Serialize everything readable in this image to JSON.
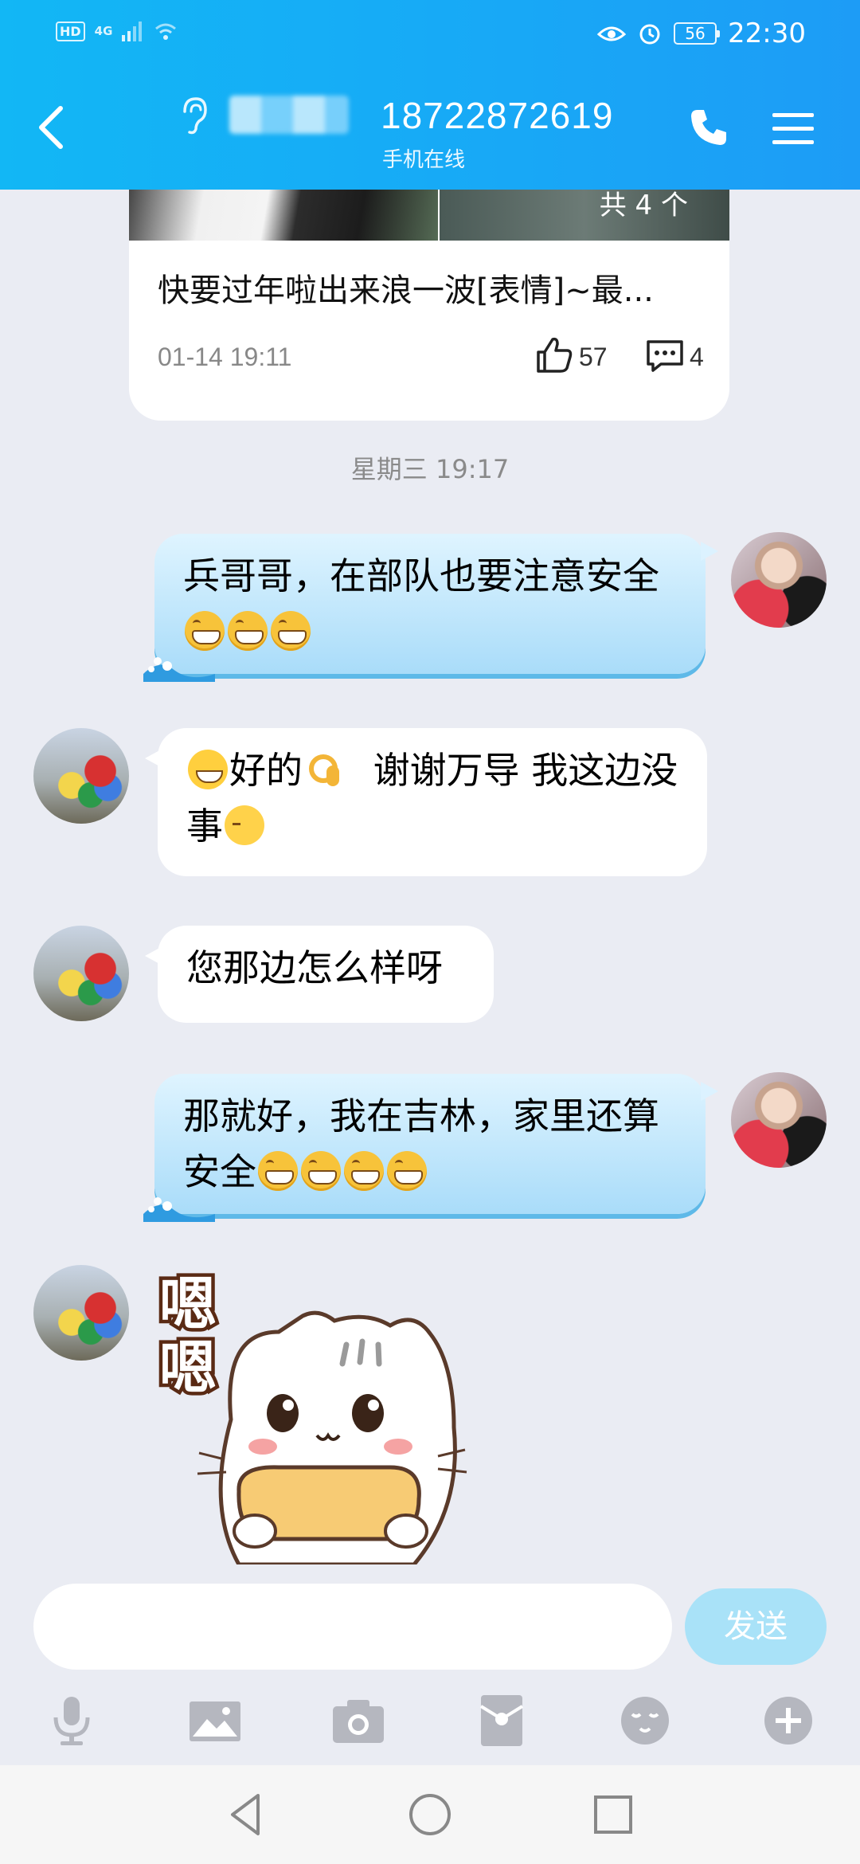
{
  "status_bar": {
    "hd": "HD",
    "network": "4G",
    "battery": "56",
    "time": "22:30"
  },
  "header": {
    "title": "18722872619",
    "subtitle": "手机在线"
  },
  "card": {
    "image_count": "共 4 个",
    "text": "快要过年啦出来浪一波[表情]~最...",
    "date": "01-14 19:11",
    "likes": "57",
    "comments": "4"
  },
  "timestamp": "星期三 19:17",
  "messages": [
    {
      "sender": "me",
      "text": "兵哥哥，在部队也要注意安全",
      "emojis": [
        "grin",
        "grin",
        "grin"
      ]
    },
    {
      "sender": "other",
      "text_a": "好的",
      "text_b": "谢谢万导  我这边没事",
      "emojis": [
        "happy",
        "ok",
        "calm"
      ]
    },
    {
      "sender": "other",
      "text": "您那边怎么样呀"
    },
    {
      "sender": "me",
      "text": "那就好，我在吉林，家里还算安全",
      "emojis": [
        "grin",
        "grin",
        "grin",
        "grin"
      ]
    },
    {
      "sender": "other",
      "sticker_text": "嗯嗯"
    }
  ],
  "input": {
    "placeholder": "",
    "send_label": "发送"
  },
  "toolbar": [
    "microphone-icon",
    "image-icon",
    "camera-icon",
    "red-packet-icon",
    "emoji-icon",
    "plus-icon"
  ],
  "colors": {
    "header": "#12b7f5",
    "my_bubble": "#a9dcf9",
    "background": "#eaecf3",
    "send_button": "#a9e2f8"
  }
}
